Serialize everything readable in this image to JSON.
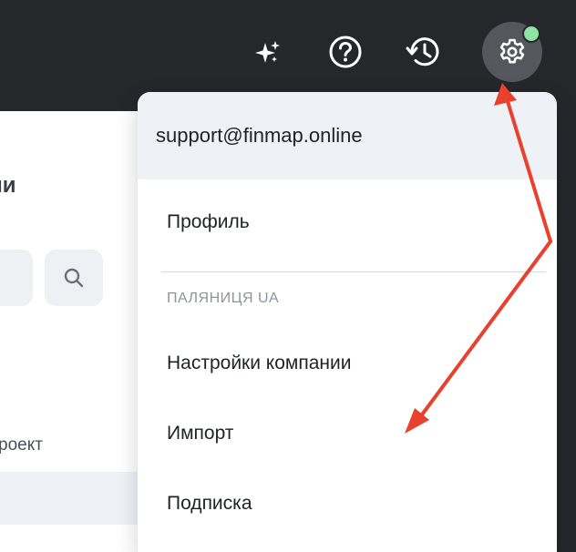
{
  "topbar": {
    "icons": [
      "sparkle-icon",
      "help-icon",
      "history-icon",
      "gear-icon"
    ],
    "status_color": "#8fe3a4"
  },
  "left_panel": {
    "heading_fragment": "ии",
    "project_fragment": "роект"
  },
  "dropdown": {
    "email": "support@finmap.online",
    "profile_label": "Профиль",
    "company_section": "ПАЛЯНИЦЯ UA",
    "items": [
      {
        "label": "Настройки компании"
      },
      {
        "label": "Импорт"
      },
      {
        "label": "Подписка"
      }
    ]
  },
  "colors": {
    "topbar_bg": "#26272a",
    "accent_arrow": "#e8412d",
    "menu_header_bg": "#eef2f6"
  }
}
